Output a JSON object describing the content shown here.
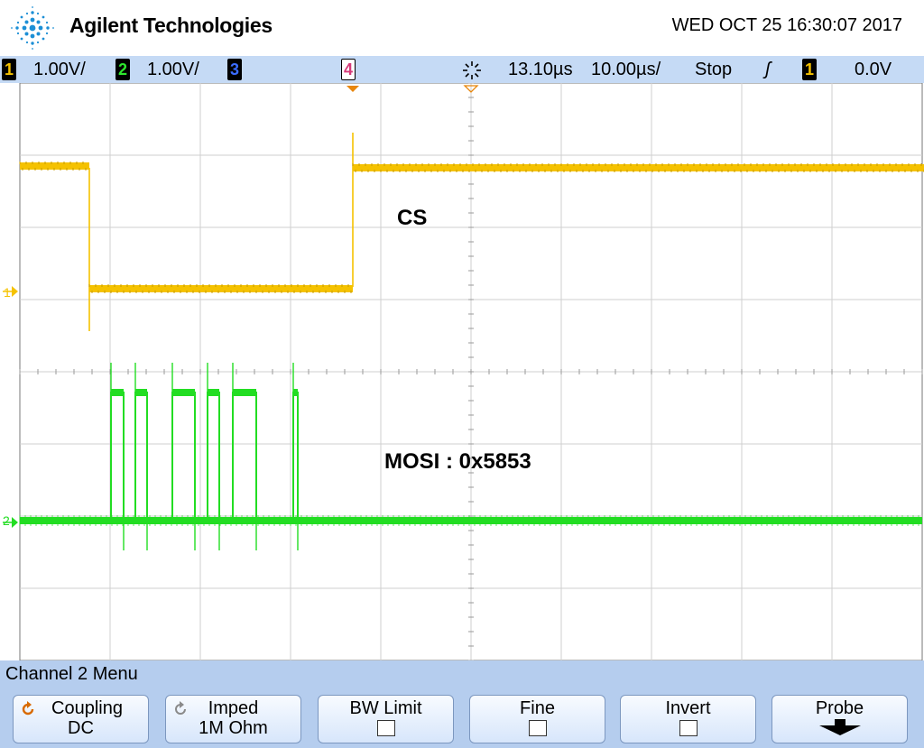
{
  "header": {
    "brand": "Agilent Technologies",
    "datetime": "WED OCT 25 16:30:07 2017",
    "logo_icon": "agilent-spark-icon"
  },
  "status": {
    "ch1": {
      "num": "1",
      "scale": "1.00V/",
      "color": "#f5c200"
    },
    "ch2": {
      "num": "2",
      "scale": "1.00V/",
      "color": "#2ee62e"
    },
    "ch3": {
      "num": "3",
      "color": "#3b6cff"
    },
    "ch4": {
      "num": "4",
      "color": "#d63a7a"
    },
    "delay": "13.10µs",
    "timebase": "10.00µs/",
    "run_state": "Stop",
    "trigger_slope": "ʃ",
    "trigger_source": "1",
    "trigger_level": "0.0V"
  },
  "screen": {
    "annotations": {
      "cs": "CS",
      "mosi": "MOSI : 0x5853"
    },
    "ch1_marker": "1",
    "ch2_marker": "2",
    "ch1_color": "#f5c200",
    "ch2_color": "#22dd22"
  },
  "menu": {
    "title": "Channel 2  Menu",
    "softkeys": [
      {
        "l1": "Coupling",
        "l2": "DC"
      },
      {
        "l1": "Imped",
        "l2": "1M Ohm"
      },
      {
        "l1": "BW Limit"
      },
      {
        "l1": "Fine"
      },
      {
        "l1": "Invert"
      },
      {
        "l1": "Probe"
      }
    ]
  }
}
